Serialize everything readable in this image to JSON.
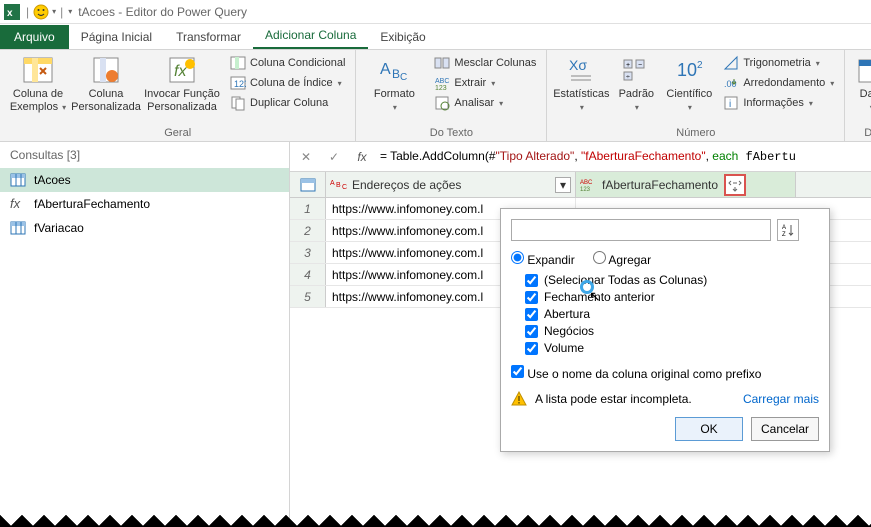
{
  "title": {
    "app": "tAcoes - Editor do Power Query",
    "sep": "|"
  },
  "tabs": {
    "arquivo": "Arquivo",
    "inicio": "Página Inicial",
    "transformar": "Transformar",
    "adicionar": "Adicionar Coluna",
    "exibicao": "Exibição"
  },
  "ribbon": {
    "geral": {
      "label": "Geral",
      "exemplos": "Coluna de Exemplos",
      "pers": "Coluna Personalizada",
      "invocar": "Invocar Função Personalizada",
      "cond": "Coluna Condicional",
      "indice": "Coluna de Índice",
      "dup": "Duplicar Coluna"
    },
    "texto": {
      "label": "Do Texto",
      "formato": "Formato",
      "mesclar": "Mesclar Colunas",
      "extrair": "Extrair",
      "analisar": "Analisar"
    },
    "numero": {
      "label": "Número",
      "estat": "Estatísticas",
      "padrao": "Padrão",
      "cient": "Científico",
      "trig": "Trigonometria",
      "arred": "Arredondamento",
      "info": "Informações"
    },
    "data": {
      "label": "Da",
      "data": "Data"
    }
  },
  "queries": {
    "header": "Consultas [3]",
    "items": [
      {
        "name": "tAcoes",
        "kind": "table"
      },
      {
        "name": "fAberturaFechamento",
        "kind": "fx"
      },
      {
        "name": "fVariacao",
        "kind": "table"
      }
    ]
  },
  "formula": {
    "prefix": "= Table.AddColumn(#",
    "arg1": "\"Tipo Alterado\"",
    "comma": ", ",
    "arg2": "\"fAberturaFechamento\"",
    "suffix": ", each fAbertu"
  },
  "grid": {
    "col1": "Endereços de ações",
    "col2": "fAberturaFechamento",
    "rows": [
      "https://www.infomoney.com.l",
      "https://www.infomoney.com.l",
      "https://www.infomoney.com.l",
      "https://www.infomoney.com.l",
      "https://www.infomoney.com.l"
    ]
  },
  "popup": {
    "expandir": "Expandir",
    "agregar": "Agregar",
    "all": "(Selecionar Todas as Colunas)",
    "cols": [
      "Fechamento anterior",
      "Abertura",
      "Negócios",
      "Volume"
    ],
    "prefix": "Use o nome da coluna original como prefixo",
    "warn": "A lista pode estar incompleta.",
    "more": "Carregar mais",
    "ok": "OK",
    "cancel": "Cancelar"
  }
}
